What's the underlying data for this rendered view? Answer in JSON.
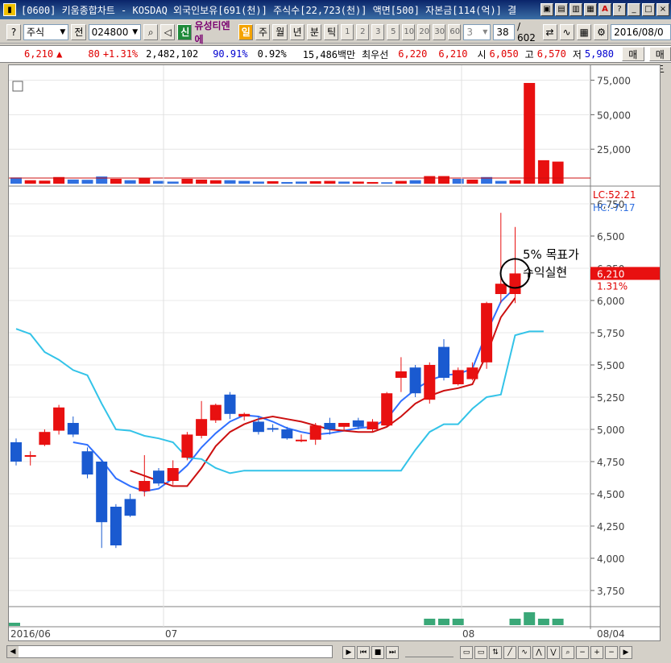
{
  "window": {
    "title": "[0600] 키움종합차트 - KOSDAQ 외국인보유[691(천)] 주식수[22,723(천)] 액면[500] 자본금[114(억)] 결"
  },
  "toolbar": {
    "market_select": "주식",
    "prev_label": "전",
    "stock_code": "024800",
    "badge_credit": "신",
    "stock_name": "유성티엔에",
    "period_day": "일",
    "period_week": "주",
    "period_month": "월",
    "period_year": "년",
    "period_minute": "분",
    "period_tick": "틱",
    "interval_options": [
      "1",
      "2",
      "3",
      "5",
      "10",
      "20",
      "30",
      "60"
    ],
    "interval_value": "3",
    "count_value": "38",
    "count_total": "/ 602",
    "date_value": "2016/08/0"
  },
  "quote": {
    "price": "6,210",
    "arrow": "▲",
    "change": "80",
    "change_pct": "+1.31%",
    "volume": "2,482,102",
    "vol_ratio": "90.91%",
    "turnover": "0.92%",
    "amount": "15,486백만",
    "best_bid_label": "최우선",
    "best_bid": "6,220",
    "best_ask": "6,210",
    "open_label": "시",
    "open": "6,050",
    "high_label": "고",
    "high": "6,570",
    "low_label": "저",
    "low": "5,980",
    "buy_button": "매수",
    "sell_button": "매도"
  },
  "annotation": {
    "line1": "5% 목표가",
    "line2": "수익실현"
  },
  "indicators": {
    "lc": "LC:52.21",
    "hc": "HC:-7.17"
  },
  "price_tag": {
    "price": "6,210",
    "pct": "1.31%"
  },
  "chart_data": [
    {
      "type": "bar",
      "title": "",
      "y_ticks": [
        "75,000",
        "50,000",
        "25,000"
      ],
      "ylim": [
        0,
        80000
      ],
      "values": [
        4500,
        2500,
        2200,
        4800,
        3000,
        2800,
        5200,
        3500,
        2500,
        4000,
        2000,
        1500,
        3500,
        3000,
        2500,
        2500,
        2000,
        1500,
        1800,
        1200,
        1500,
        1800,
        2000,
        1500,
        1500,
        1200,
        1000,
        2000,
        2500,
        5500,
        5500,
        3500,
        3000,
        4800,
        2000,
        2500,
        73000,
        17000,
        16000
      ],
      "colors": [
        "b",
        "r",
        "r",
        "r",
        "b",
        "b",
        "b",
        "r",
        "b",
        "r",
        "b",
        "b",
        "r",
        "r",
        "r",
        "b",
        "b",
        "b",
        "r",
        "b",
        "b",
        "r",
        "r",
        "b",
        "r",
        "r",
        "b",
        "r",
        "b",
        "r",
        "r",
        "b",
        "r",
        "b",
        "b",
        "r",
        "r",
        "r",
        "r"
      ]
    },
    {
      "type": "candlestick",
      "title": "",
      "y_ticks": [
        "6,750",
        "6,500",
        "6,250",
        "6,000",
        "5,750",
        "5,500",
        "5,250",
        "5,000",
        "4,750",
        "4,500",
        "4,250",
        "4,000",
        "3,750"
      ],
      "ylim": [
        3625,
        6875
      ],
      "x_labels": [
        "2016/06",
        "07",
        "08",
        "08/04"
      ],
      "candles": [
        [
          4900,
          4750,
          4930,
          4720
        ],
        [
          4800,
          4800,
          4830,
          4720
        ],
        [
          4880,
          4980,
          5000,
          4870
        ],
        [
          4990,
          5170,
          5190,
          4960
        ],
        [
          5050,
          4960,
          5100,
          4940
        ],
        [
          4830,
          4650,
          4860,
          4620
        ],
        [
          4750,
          4280,
          4760,
          4080
        ],
        [
          4400,
          4100,
          4420,
          4080
        ],
        [
          4460,
          4330,
          4500,
          4320
        ],
        [
          4520,
          4600,
          4800,
          4480
        ],
        [
          4680,
          4580,
          4700,
          4560
        ],
        [
          4600,
          4700,
          4760,
          4570
        ],
        [
          4780,
          4960,
          4980,
          4760
        ],
        [
          4950,
          5080,
          5220,
          4930
        ],
        [
          5070,
          5190,
          5200,
          5050
        ],
        [
          5270,
          5120,
          5290,
          5080
        ],
        [
          5100,
          5120,
          5130,
          5070
        ],
        [
          5060,
          4980,
          5100,
          4960
        ],
        [
          5010,
          5000,
          5040,
          4980
        ],
        [
          5000,
          4930,
          5020,
          4920
        ],
        [
          4920,
          4920,
          4960,
          4900
        ],
        [
          4920,
          5030,
          5050,
          4880
        ],
        [
          5050,
          5000,
          5090,
          4960
        ],
        [
          5020,
          5050,
          5050,
          4990
        ],
        [
          5070,
          5020,
          5090,
          5000
        ],
        [
          5000,
          5060,
          5080,
          4980
        ],
        [
          5030,
          5280,
          5290,
          5020
        ],
        [
          5400,
          5450,
          5560,
          5290
        ],
        [
          5480,
          5280,
          5500,
          5250
        ],
        [
          5230,
          5500,
          5520,
          5200
        ],
        [
          5640,
          5400,
          5700,
          5380
        ],
        [
          5350,
          5460,
          5480,
          5340
        ],
        [
          5390,
          5480,
          5520,
          5380
        ],
        [
          5520,
          5980,
          5990,
          5470
        ],
        [
          6050,
          6130,
          6680,
          5980
        ],
        [
          6050,
          6210,
          6570,
          5980
        ]
      ],
      "series": [
        {
          "name": "",
          "color": "#3070ff",
          "values": [
            null,
            null,
            null,
            null,
            4900,
            4880,
            4760,
            4620,
            4560,
            4520,
            4540,
            4620,
            4720,
            4860,
            4970,
            5060,
            5110,
            5100,
            5060,
            5010,
            4980,
            4960,
            4970,
            4990,
            5010,
            5020,
            5080,
            5220,
            5310,
            5380,
            5420,
            5430,
            5470,
            5750,
            5990,
            6100
          ]
        },
        {
          "name": "",
          "color": "#cc1010",
          "values": [
            null,
            null,
            null,
            null,
            null,
            null,
            null,
            null,
            4680,
            4640,
            4600,
            4560,
            4560,
            4700,
            4870,
            4980,
            5040,
            5080,
            5100,
            5080,
            5060,
            5030,
            5000,
            4990,
            4980,
            4980,
            5020,
            5100,
            5200,
            5260,
            5300,
            5320,
            5350,
            5580,
            5870,
            6020
          ]
        },
        {
          "name": "",
          "color": "#33c3e8",
          "values": [
            5780,
            5740,
            5600,
            5540,
            5460,
            5420,
            5200,
            5000,
            4990,
            4950,
            4930,
            4900,
            4780,
            4770,
            4700,
            4660,
            4680,
            4680,
            4680,
            4680,
            4680,
            4680,
            4680,
            4680,
            4680,
            4680,
            4680,
            4680,
            4840,
            4980,
            5040,
            5040,
            5160,
            5250,
            5270,
            5730,
            5760,
            5760
          ]
        }
      ]
    }
  ],
  "volume_strip": [
    0,
    0,
    0,
    0,
    0,
    0,
    0,
    0,
    0,
    0,
    0,
    0,
    0,
    0,
    0,
    0,
    0,
    0,
    0,
    0,
    0,
    0,
    0,
    0,
    0,
    0,
    0,
    0,
    0,
    1,
    1,
    1,
    0,
    0,
    0,
    1,
    2,
    1,
    1
  ],
  "statusbar_icons": [
    "first-icon",
    "prev-icon",
    "stop-icon",
    "next-icon",
    "last-icon",
    "zoom-out-icon",
    "zoom-in-icon",
    "plus-icon",
    "minus-icon",
    "scroll-right-icon"
  ]
}
